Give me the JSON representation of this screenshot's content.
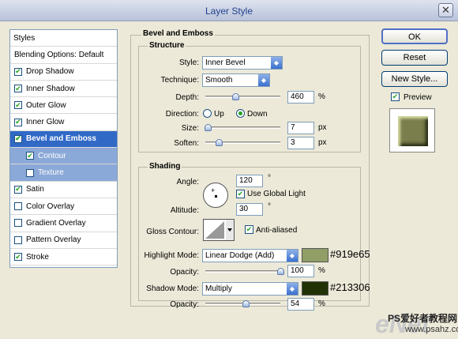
{
  "window": {
    "title": "Layer Style",
    "close_glyph": "✕"
  },
  "styles_panel": {
    "header": "Styles",
    "items": [
      {
        "label": "Blending Options: Default",
        "checkbox": false,
        "checked": false
      },
      {
        "label": "Drop Shadow",
        "checkbox": true,
        "checked": true
      },
      {
        "label": "Inner Shadow",
        "checkbox": true,
        "checked": true
      },
      {
        "label": "Outer Glow",
        "checkbox": true,
        "checked": true
      },
      {
        "label": "Inner Glow",
        "checkbox": true,
        "checked": true
      },
      {
        "label": "Bevel and Emboss",
        "checkbox": true,
        "checked": true,
        "selected": true
      },
      {
        "label": "Contour",
        "checkbox": true,
        "checked": true,
        "sub": true
      },
      {
        "label": "Texture",
        "checkbox": true,
        "checked": false,
        "sub": true
      },
      {
        "label": "Satin",
        "checkbox": true,
        "checked": true
      },
      {
        "label": "Color Overlay",
        "checkbox": true,
        "checked": false
      },
      {
        "label": "Gradient Overlay",
        "checkbox": true,
        "checked": false
      },
      {
        "label": "Pattern Overlay",
        "checkbox": true,
        "checked": false
      },
      {
        "label": "Stroke",
        "checkbox": true,
        "checked": true
      }
    ]
  },
  "bevel": {
    "title": "Bevel and Emboss",
    "structure": {
      "title": "Structure",
      "style_label": "Style:",
      "style_value": "Inner Bevel",
      "technique_label": "Technique:",
      "technique_value": "Smooth",
      "depth_label": "Depth:",
      "depth_value": "460",
      "depth_unit": "%",
      "depth_slider": 0.4,
      "direction_label": "Direction:",
      "dir_up": "Up",
      "dir_down": "Down",
      "direction_value": "Down",
      "size_label": "Size:",
      "size_value": "7",
      "size_unit": "px",
      "size_slider": 0.03,
      "soften_label": "Soften:",
      "soften_value": "3",
      "soften_unit": "px",
      "soften_slider": 0.18
    },
    "shading": {
      "title": "Shading",
      "angle_label": "Angle:",
      "angle_value": "120",
      "angle_unit": "°",
      "global_light_label": "Use Global Light",
      "global_light": true,
      "altitude_label": "Altitude:",
      "altitude_value": "30",
      "altitude_unit": "°",
      "gloss_label": "Gloss Contour:",
      "anti_aliased_label": "Anti-aliased",
      "anti_aliased": true,
      "highlight_label": "Highlight Mode:",
      "highlight_value": "Linear Dodge (Add)",
      "highlight_color": "#919e65",
      "highlight_hex": "#919e65",
      "hl_opacity_label": "Opacity:",
      "hl_opacity_value": "100",
      "hl_opacity_unit": "%",
      "hl_opacity_slider": 1.0,
      "shadow_label": "Shadow Mode:",
      "shadow_value": "Multiply",
      "shadow_color": "#213306",
      "shadow_hex": "#213306",
      "sh_opacity_label": "Opacity:",
      "sh_opacity_value": "54",
      "sh_opacity_unit": "%",
      "sh_opacity_slider": 0.54
    }
  },
  "buttons": {
    "ok": "OK",
    "reset": "Reset",
    "new_style": "New Style...",
    "preview_label": "Preview",
    "preview": true
  },
  "watermark": {
    "logo": "eNet",
    "line1": "PS爱好者教程网",
    "line2": "www.psahz.com"
  }
}
